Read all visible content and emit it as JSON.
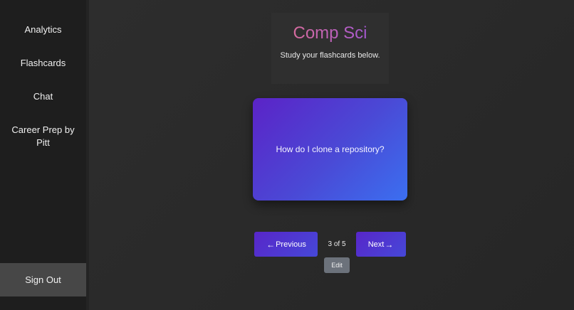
{
  "sidebar": {
    "items": [
      {
        "label": "Analytics"
      },
      {
        "label": "Flashcards"
      },
      {
        "label": "Chat"
      },
      {
        "label": "Career Prep by Pitt"
      }
    ],
    "signout_label": "Sign Out"
  },
  "header": {
    "title": "Comp Sci",
    "subtitle": "Study your flashcards below."
  },
  "flashcard": {
    "question": "How do I clone a repository?"
  },
  "controls": {
    "prev_label": "Previous",
    "next_label": "Next",
    "counter": "3 of 5",
    "edit_label": "Edit"
  },
  "icons": {
    "prev": "arrow-left-icon",
    "next": "arrow-right-icon"
  },
  "colors": {
    "accent_start": "#5b23c7",
    "accent_end": "#3b6ff0",
    "title_gradient_start": "#e2708e",
    "title_gradient_end": "#8b4fd9",
    "sidebar_bg": "#1e1e1e",
    "signout_bg": "#474747",
    "edit_bg": "#6c727b"
  }
}
